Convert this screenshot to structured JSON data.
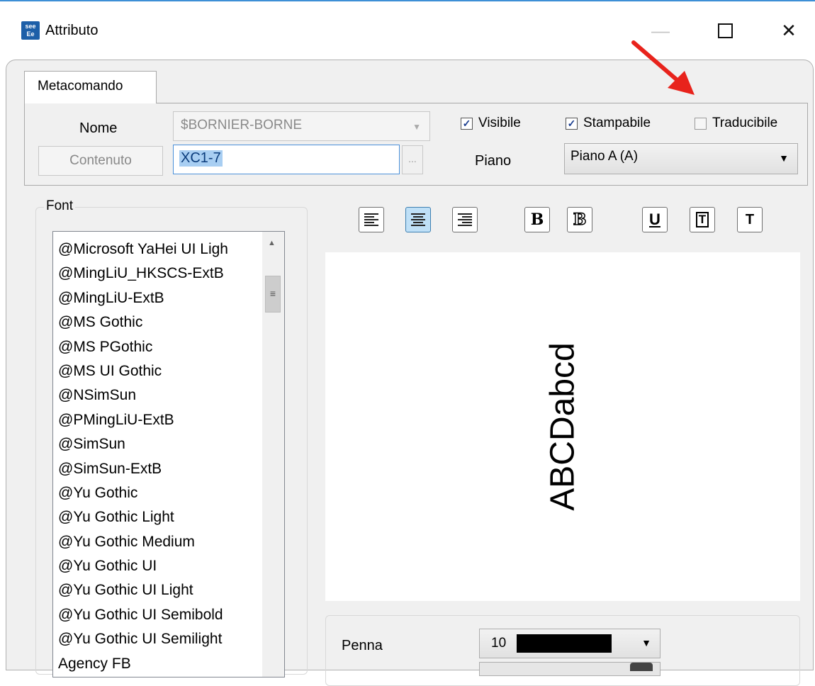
{
  "window": {
    "title": "Attributo",
    "icon_label": "see Ee",
    "controls": {
      "minimize": "—",
      "close": "✕"
    }
  },
  "tab": {
    "label": "Metacomando"
  },
  "form": {
    "nome_label": "Nome",
    "nome_value": "$BORNIER-BORNE",
    "contenuto_button": "Contenuto",
    "text_value": "XC1-7",
    "ellipsis": "...",
    "piano_label": "Piano",
    "piano_value": "Piano A (A)",
    "visibile": {
      "label": "Visibile",
      "checked": true
    },
    "stampabile": {
      "label": "Stampabile",
      "checked": true
    },
    "traducibile": {
      "label": "Traducibile",
      "checked": false
    }
  },
  "font": {
    "legend": "Font",
    "items": [
      "@Microsoft YaHei UI Ligh",
      "@MingLiU_HKSCS-ExtB",
      "@MingLiU-ExtB",
      "@MS Gothic",
      "@MS PGothic",
      "@MS UI Gothic",
      "@NSimSun",
      "@PMingLiU-ExtB",
      "@SimSun",
      "@SimSun-ExtB",
      "@Yu Gothic",
      "@Yu Gothic Light",
      "@Yu Gothic Medium",
      "@Yu Gothic UI",
      "@Yu Gothic UI Light",
      "@Yu Gothic UI Semibold",
      "@Yu Gothic UI Semilight",
      "Agency FB"
    ]
  },
  "toolbar": {
    "bold": "B",
    "bold_outline": "B",
    "underline": "U",
    "frame": "T",
    "plain": "T"
  },
  "preview": {
    "text": "ABCDabcd"
  },
  "pen": {
    "label": "Penna",
    "value": "10",
    "color": "#000000"
  },
  "colors": {
    "accent": "#3d8fd6",
    "annotation": "#e8231c",
    "selection": "#a8cef2"
  }
}
